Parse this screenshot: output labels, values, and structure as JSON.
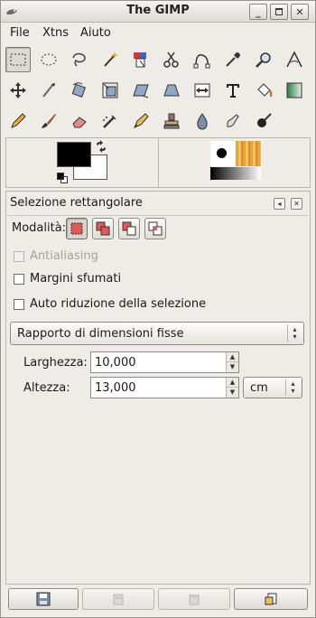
{
  "window": {
    "title": "The GIMP",
    "controls": [
      "minimize-icon",
      "maximize-icon",
      "close-icon"
    ]
  },
  "menubar": {
    "items": [
      {
        "label": "File",
        "mnemonic": "F"
      },
      {
        "label": "Xtns",
        "mnemonic": "X"
      },
      {
        "label": "Aiuto",
        "mnemonic": "A"
      }
    ]
  },
  "toolbox": {
    "active_tool": "rect-select-tool",
    "tools": [
      "rect-select-icon",
      "ellipse-select-icon",
      "lasso-icon",
      "magic-wand-icon",
      "select-by-color-icon",
      "scissors-icon",
      "paths-icon",
      "color-picker-icon",
      "zoom-icon",
      "measure-icon",
      "move-icon",
      "crop-icon",
      "rotate-icon",
      "scale-icon",
      "shear-icon",
      "perspective-icon",
      "flip-icon",
      "text-icon",
      "bucket-fill-icon",
      "blend-icon",
      "pencil-icon",
      "paintbrush-icon",
      "eraser-icon",
      "airbrush-icon",
      "ink-icon",
      "clone-icon",
      "blur-icon",
      "smudge-icon",
      "dodge-burn-icon"
    ]
  },
  "colors": {
    "foreground": "#000000",
    "background": "#ffffff",
    "accent_mode": "#e05a5a"
  },
  "tool_options": {
    "title": "Selezione rettangolare",
    "mode_label": "Modalità:",
    "modes": [
      "replace-mode-icon",
      "add-mode-icon",
      "subtract-mode-icon",
      "intersect-mode-icon"
    ],
    "antialiasing_label": "Antialiasing",
    "feather_label": "Margini sfumati",
    "auto_shrink_label": "Auto riduzione della selezione",
    "fixed_mode_value": "Rapporto di dimensioni fisse",
    "width_label": "Larghezza:",
    "width_value": "10,000",
    "height_label": "Altezza:",
    "height_value": "13,000",
    "unit_value": "cm"
  },
  "bottom_buttons": [
    "save-options-icon",
    "restore-options-icon",
    "delete-options-icon",
    "reset-options-icon"
  ]
}
